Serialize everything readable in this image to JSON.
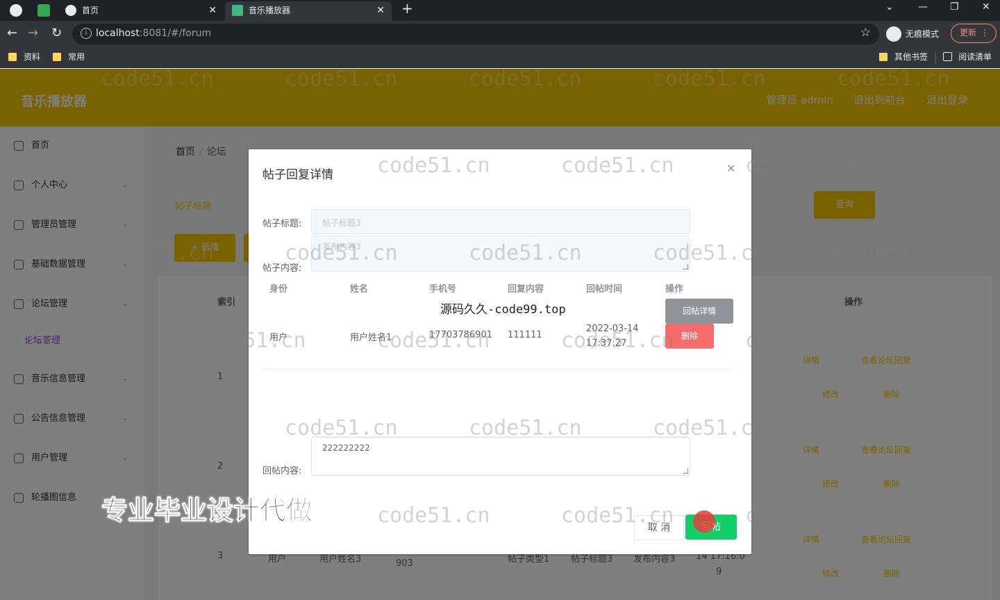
{
  "browser": {
    "tabs": [
      {
        "title": "首页",
        "active": false
      },
      {
        "title": "音乐播放器",
        "active": true
      }
    ],
    "new_tab": "+",
    "url_host": "localhost",
    "url_rest": ":8081/#/forum",
    "incognito_label": "无痕模式",
    "update_label": "更新",
    "bookmarks": [
      "资料",
      "常用"
    ],
    "other_bookmarks": "其他书签",
    "reading_list": "阅读清单"
  },
  "app": {
    "title": "音乐播放器",
    "header_links": [
      "管理员 admin",
      "退出到前台",
      "退出登录"
    ],
    "sidebar": [
      {
        "label": "首页",
        "icon": "home-icon"
      },
      {
        "label": "个人中心",
        "icon": "user-icon"
      },
      {
        "label": "管理员管理",
        "icon": "admin-icon"
      },
      {
        "label": "基础数据管理",
        "icon": "data-icon"
      },
      {
        "label": "论坛管理",
        "icon": "forum-icon"
      },
      {
        "label": "论坛管理",
        "icon": "",
        "sub": true
      },
      {
        "label": "音乐信息管理",
        "icon": "music-icon"
      },
      {
        "label": "公告信息管理",
        "icon": "notice-icon"
      },
      {
        "label": "用户管理",
        "icon": "users-icon"
      },
      {
        "label": "轮播图信息",
        "icon": "carousel-icon"
      }
    ],
    "breadcrumb": {
      "home": "首页",
      "current": "论坛"
    },
    "search_label": "帖子标题",
    "search_btn": "查询",
    "add_btn": "+ 新增",
    "table_headers": {
      "index": "索引",
      "action": "操作"
    },
    "rows": [
      {
        "index": "1",
        "actions": [
          "详情",
          "查看论坛回复",
          "修改",
          "删除"
        ]
      },
      {
        "index": "2",
        "actions": [
          "详情",
          "查看论坛回复",
          "修改",
          "删除"
        ]
      },
      {
        "index": "3",
        "identity": "用户",
        "name": "用户姓名3",
        "phone_tail": "903",
        "type": "帖子类型1",
        "title": "帖子标题3",
        "content": "发布内容3",
        "time": "14 17:16:0",
        "time2": "9",
        "actions": [
          "详情",
          "查看论坛回复",
          "修改",
          "删除"
        ]
      }
    ]
  },
  "dialog": {
    "title": "帖子回复详情",
    "title_label": "帖子标题:",
    "title_value": "帖子标题3",
    "content_label": "帖子内容:",
    "content_value": "发布内容3",
    "reply_headers": [
      "身份",
      "姓名",
      "手机号",
      "回复内容",
      "回帖时间",
      "操作"
    ],
    "reply_row": {
      "identity": "用户",
      "name": "用户姓名1",
      "phone": "17703786901",
      "content": "111111",
      "time": "2022-03-14 17:37:27",
      "detail_btn": "回帖详情",
      "delete_btn": "删除"
    },
    "reply_label": "回帖内容:",
    "reply_value": "222222222",
    "cancel_btn": "取 消",
    "submit_btn": "回帖"
  },
  "overlays": {
    "watermark": "code51.cn",
    "source": "源码久久-code99.top",
    "promo": "专业毕业设计代做"
  },
  "colors": {
    "brand": "#f5c400",
    "success": "#13ce66",
    "danger": "#f56c6c",
    "info": "#909399"
  }
}
